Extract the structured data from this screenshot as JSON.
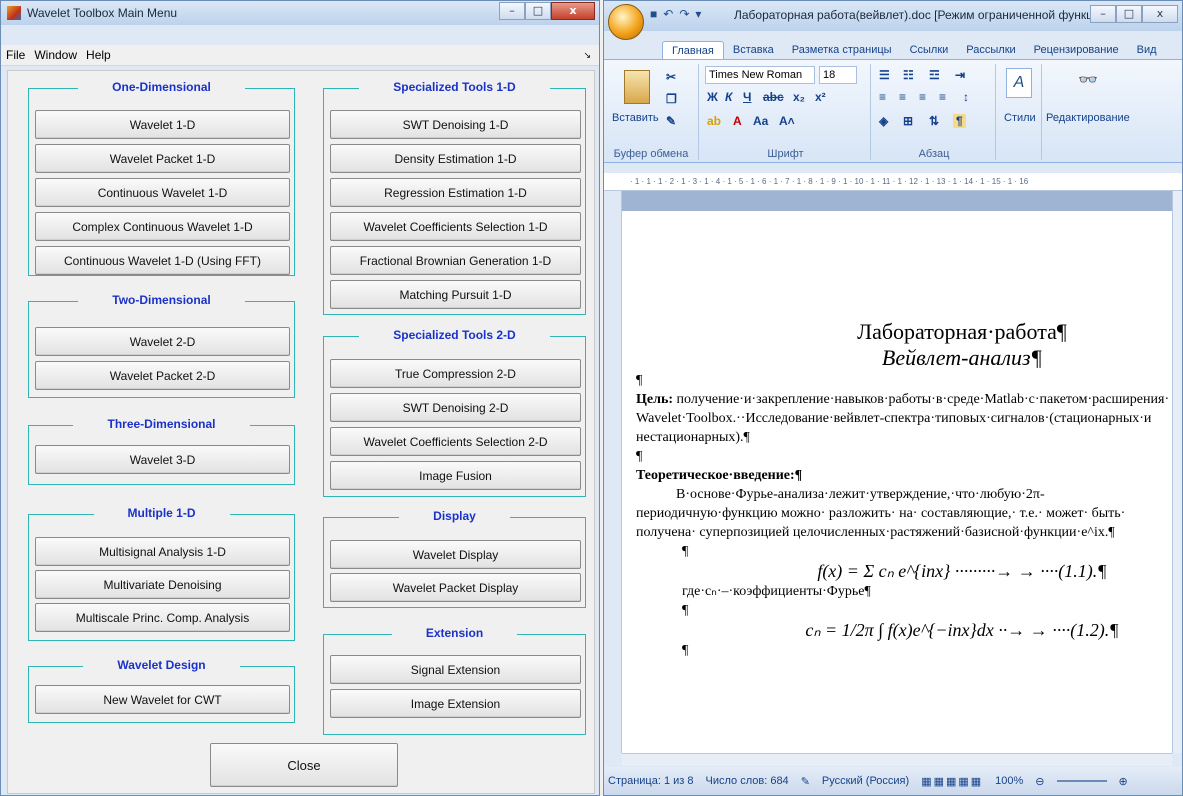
{
  "wavelet_toolbox": {
    "title": "Wavelet Toolbox Main Menu",
    "menu": [
      "File",
      "Window",
      "Help"
    ],
    "menu_arrow": "↘",
    "panels": {
      "one_d": {
        "title": "One-Dimensional",
        "buttons": [
          "Wavelet 1-D",
          "Wavelet Packet 1-D",
          "Continuous Wavelet 1-D",
          "Complex Continuous Wavelet 1-D",
          "Continuous Wavelet 1-D (Using FFT)"
        ]
      },
      "two_d": {
        "title": "Two-Dimensional",
        "buttons": [
          "Wavelet 2-D",
          "Wavelet Packet 2-D"
        ]
      },
      "three_d": {
        "title": "Three-Dimensional",
        "buttons": [
          "Wavelet 3-D"
        ]
      },
      "multiple": {
        "title": "Multiple 1-D",
        "buttons": [
          "Multisignal Analysis 1-D",
          "Multivariate Denoising",
          "Multiscale Princ. Comp. Analysis"
        ]
      },
      "design": {
        "title": "Wavelet Design",
        "buttons": [
          "New Wavelet for CWT"
        ]
      },
      "spec1d": {
        "title": "Specialized Tools 1-D",
        "buttons": [
          "SWT Denoising 1-D",
          "Density Estimation 1-D",
          "Regression Estimation 1-D",
          "Wavelet Coefficients Selection 1-D",
          "Fractional Brownian Generation 1-D",
          "Matching Pursuit 1-D"
        ]
      },
      "spec2d": {
        "title": "Specialized Tools 2-D",
        "buttons": [
          "True Compression 2-D",
          "SWT Denoising 2-D",
          "Wavelet Coefficients Selection 2-D",
          "Image Fusion"
        ]
      },
      "display": {
        "title": "Display",
        "buttons": [
          "Wavelet Display",
          "Wavelet Packet Display"
        ]
      },
      "extension": {
        "title": "Extension",
        "buttons": [
          "Signal Extension",
          "Image Extension"
        ]
      }
    },
    "close_label": "Close"
  },
  "word": {
    "title": "Лабораторная работа(вейвлет).doc [Режим ограниченной функцио...",
    "tabs": [
      "Главная",
      "Вставка",
      "Разметка страницы",
      "Ссылки",
      "Рассылки",
      "Рецензирование",
      "Вид"
    ],
    "paste_label": "Вставить",
    "font_name": "Times New Roman",
    "font_size": "18",
    "styles_label": "Стили",
    "editing_label": "Редактирование",
    "groups": [
      "Буфер обмена",
      "Шрифт",
      "Абзац"
    ],
    "ruler": "· 1 · 1 · 1 · 2 · 1 · 3 · 1 · 4 · 1 · 5 · 1 · 6 · 1 · 7 · 1 · 8 · 1 · 9 · 1 · 10 · 1 · 11 · 1 · 12 · 1 · 13 · 1 · 14 · 1 · 15 · 1 · 16",
    "doc": {
      "h1": "Лабораторная·работа¶",
      "h2": "Вейвлет-анализ¶",
      "pilcrow": "¶",
      "goal_label": "Цель:",
      "goal_text": " получение·и·закрепление·навыков·работы·в·среде·Matlab·с·пакетом·расширения· Wavelet·Toolbox.··Исследование·вейвлет-спектра·типовых·сигналов·(стационарных·и нестационарных).¶",
      "theory_heading": "Теоретическое·введение:¶",
      "theory_text": "В·основе·Фурье-анализа·лежит·утверждение,·что·любую·2π-периодичную·функцию можно· разложить· на· составляющие,· т.е.· может· быть· получена· суперпозицией целочисленных·растяжений·базисной·функции·e^ix.¶",
      "formula1": "f(x) = Σ cₙ e^{inx}  ·········→ → ····(1.1).¶",
      "where": "где·cₙ·–·коэффициенты·Фурье¶",
      "formula2": "cₙ = 1/2π ∫ f(x)e^{−inx}dx ··→ → ····(1.2).¶"
    },
    "status": {
      "page": "Страница: 1 из 8",
      "words": "Число слов: 684",
      "lang": "Русский (Россия)",
      "zoom": "100%"
    }
  }
}
